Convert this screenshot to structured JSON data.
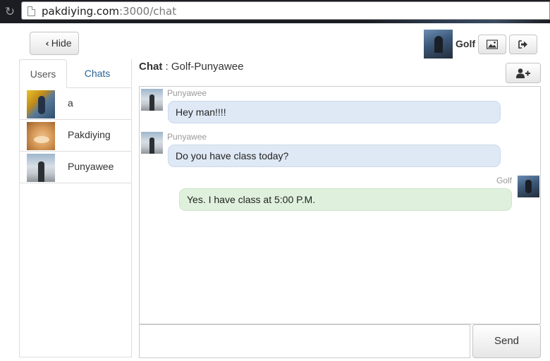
{
  "browser": {
    "url_host": "pakdiying.com",
    "url_rest": ":3000/chat"
  },
  "toolbar": {
    "hide_label": "Hide",
    "current_user": "Golf"
  },
  "tabs": [
    {
      "label": "Users",
      "active": true
    },
    {
      "label": "Chats",
      "active": false
    }
  ],
  "users": [
    {
      "name": "a"
    },
    {
      "name": "Pakdiying"
    },
    {
      "name": "Punyawee"
    }
  ],
  "chat": {
    "title_label": "Chat",
    "separator": " : ",
    "title_name": "Golf-Punyawee"
  },
  "messages": [
    {
      "sender": "Punyawee",
      "text": "Hey man!!!!",
      "direction": "in"
    },
    {
      "sender": "Punyawee",
      "text": "Do you have class today?",
      "direction": "in"
    },
    {
      "sender": "Golf",
      "text": "Yes. I have class at 5:00 P.M.",
      "direction": "out"
    }
  ],
  "composer": {
    "value": "",
    "send_label": "Send"
  },
  "colors": {
    "incoming_bubble": "#dfe9f5",
    "outgoing_bubble": "#dff1dd",
    "link": "#2a6496"
  }
}
